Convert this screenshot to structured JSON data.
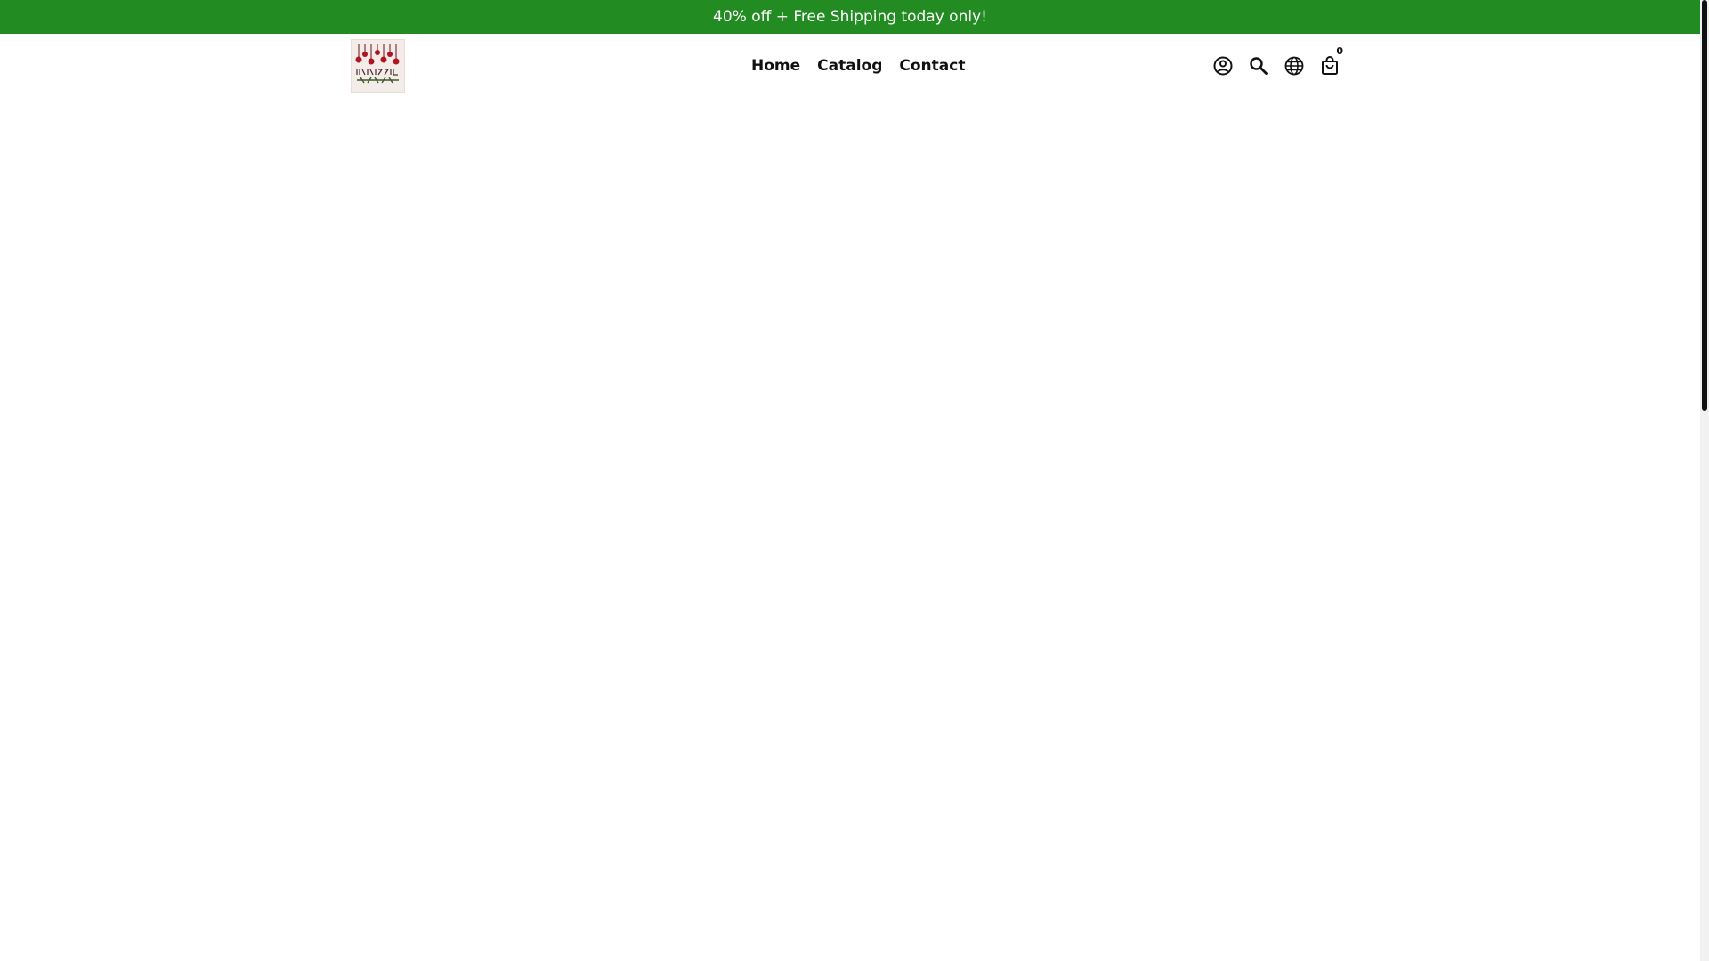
{
  "announcement": {
    "text": "40% off + Free Shipping today only!"
  },
  "logo": {
    "alt": "HOLIDAZZLE"
  },
  "nav": {
    "home": "Home",
    "catalog": "Catalog",
    "contact": "Contact"
  },
  "header_icons": {
    "account": "account-icon",
    "search": "search-icon",
    "language": "globe-icon",
    "cart": "cart-icon",
    "cart_count": "0"
  },
  "colors": {
    "announcement_bg": "#228b22",
    "logo_ornaments": "#b3121f",
    "text": "#111111"
  }
}
